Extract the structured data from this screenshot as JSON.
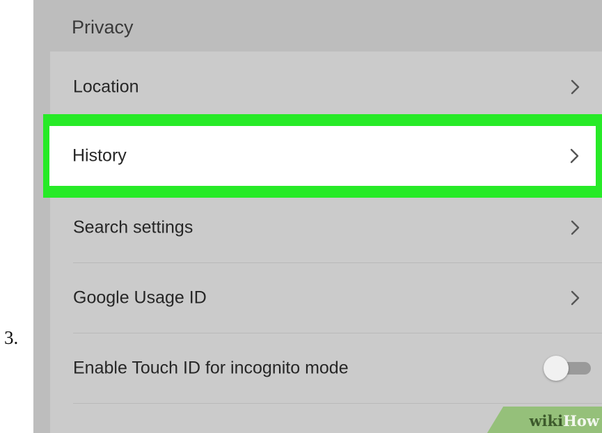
{
  "step": {
    "number": "3."
  },
  "section": {
    "title": "Privacy"
  },
  "settings": {
    "items": [
      {
        "label": "Location",
        "control": "chevron-right-icon"
      },
      {
        "label": "History",
        "control": "chevron-right-icon",
        "highlighted": true
      },
      {
        "label": "Search settings",
        "control": "chevron-right-icon"
      },
      {
        "label": "Google Usage ID",
        "control": "chevron-right-icon"
      },
      {
        "label": "Enable Touch ID for incognito mode",
        "control": "toggle",
        "toggle_on": false
      }
    ]
  },
  "watermark": {
    "part1": "wiki",
    "part2": "How"
  },
  "colors": {
    "highlight": "#27ea27",
    "screen_background": "#bdbdbd",
    "card_background": "#cbcbcb",
    "watermark": "#95c07a"
  }
}
